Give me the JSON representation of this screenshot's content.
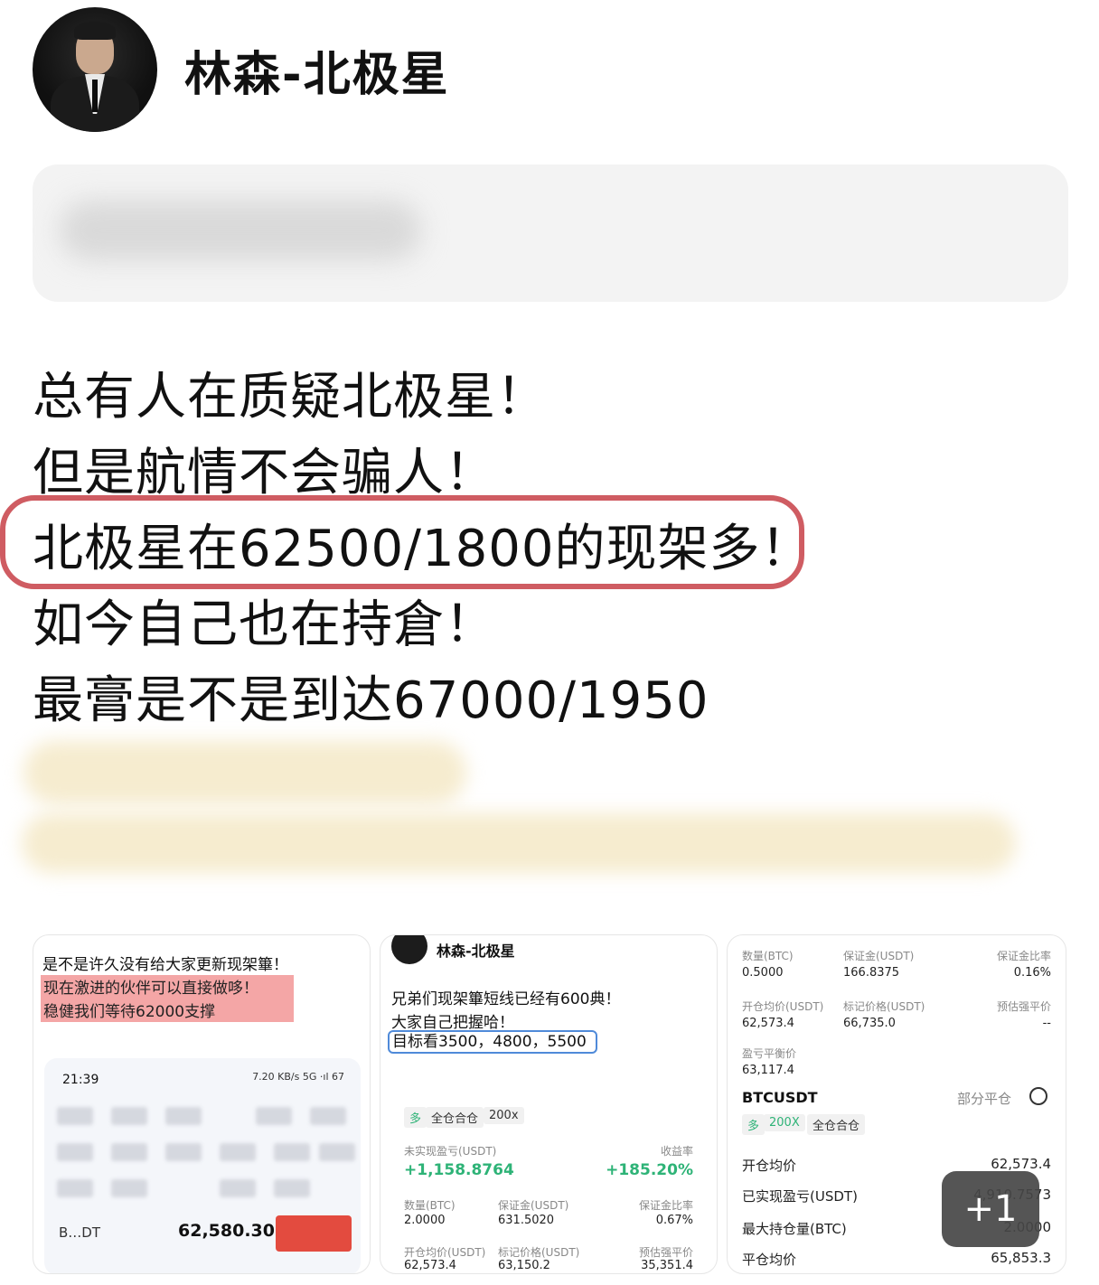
{
  "profile": {
    "username": "林森-北极星"
  },
  "post": {
    "lines": [
      "总有人在质疑北极星！",
      "但是航情不会骗人！",
      "北极星在62500/1800的现架多！",
      "如今自己也在持倉！",
      "最膏是不是到达67000/1950"
    ]
  },
  "thumbnails": {
    "first": {
      "line1": "是不是许久没有给大家更新现架篳！",
      "line2": "现在激进的伙伴可以直接做哆！",
      "line3": "稳健我们等待62000支撑",
      "time": "21:39",
      "status": "7.20 KB/s 5G ·ıl 67",
      "symbol": "B…DT",
      "price": "62,580.30"
    },
    "second": {
      "author": "林森-北极星",
      "line1": "兄弟们现架篳短线已经有600典！",
      "line2": "大家自己把握哈！",
      "line3": "目标看3500，4800，5500",
      "tags": [
        "多",
        "全仓合仓",
        "200x"
      ],
      "unrealized_label": "未实现盈亏(USDT)",
      "unrealized_value": "+1,158.8764",
      "roi_label": "收益率",
      "roi_value": "+185.20%",
      "qty_label": "数量(BTC)",
      "qty_value": "2.0000",
      "margin_label": "保证金(USDT)",
      "margin_value": "631.5020",
      "ratio_label": "保证金比率",
      "ratio_value": "0.67%",
      "entry_label": "开仓均价(USDT)",
      "entry_value": "62,573.4",
      "mark_label": "标记价格(USDT)",
      "mark_value": "63,150.2",
      "liq_label": "预估强平价",
      "liq_value": "35,351.4"
    },
    "third": {
      "qty_label": "数量(BTC)",
      "qty_value": "0.5000",
      "margin_label": "保证金(USDT)",
      "margin_value": "166.8375",
      "ratio_label": "保证金比率",
      "ratio_value": "0.16%",
      "entry_label": "开仓均价(USDT)",
      "entry_value": "62,573.4",
      "mark_label": "标记价格(USDT)",
      "mark_value": "66,735.0",
      "liq_label": "预估强平价",
      "liq_value": "--",
      "breakeven_label": "盈亏平衡价",
      "breakeven_value": "63,117.4",
      "symbol": "BTCUSDT",
      "partial_close": "部分平仓",
      "tags": [
        "多",
        "200X",
        "全仓合仓"
      ],
      "rows": [
        {
          "label": "开仓均价",
          "value": "62,573.4"
        },
        {
          "label": "已实现盈亏(USDT)",
          "value": "4,910.7573"
        },
        {
          "label": "最大持仓量(BTC)",
          "value": "2.0000"
        },
        {
          "label": "平仓均价",
          "value": "65,853.3"
        }
      ]
    },
    "more_count": "+1"
  },
  "colors": {
    "highlight_ring": "#cf5c62",
    "profit_green": "#2eb377",
    "box_blue": "#4f8ad9",
    "pink_highlight": "#f4a6a6"
  }
}
